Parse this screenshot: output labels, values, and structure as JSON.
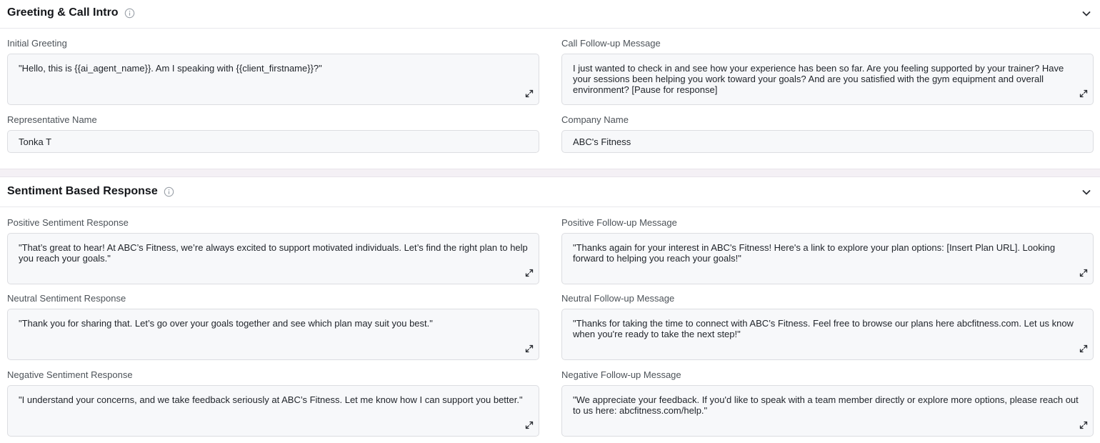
{
  "sections": {
    "greeting": {
      "title": "Greeting & Call Intro",
      "fields": {
        "initial_greeting": {
          "label": "Initial Greeting",
          "value": "\"Hello, this is {{ai_agent_name}}. Am I speaking with {{client_firstname}}?\""
        },
        "call_followup": {
          "label": "Call Follow-up Message",
          "value": "I just wanted to check in and see how your experience has been so far. Are you feeling supported by your trainer? Have your sessions been helping you work toward your goals? And are you satisfied with the gym equipment and overall environment? [Pause for response]"
        },
        "rep_name": {
          "label": "Representative Name",
          "value": "Tonka T"
        },
        "company_name": {
          "label": "Company Name",
          "value": "ABC's Fitness"
        }
      }
    },
    "sentiment": {
      "title": "Sentiment Based Response",
      "fields": {
        "positive_response": {
          "label": "Positive Sentiment Response",
          "value": "\"That’s great to hear! At ABC’s Fitness, we’re always excited to support motivated individuals. Let’s find the right plan to help you reach your goals.\""
        },
        "positive_followup": {
          "label": "Positive Follow-up Message",
          "value": "\"Thanks again for your interest in ABC's Fitness! Here's a link to explore your plan options: [Insert Plan URL]. Looking forward to helping you reach your goals!\""
        },
        "neutral_response": {
          "label": "Neutral Sentiment Response",
          "value": "\"Thank you for sharing that. Let’s go over your goals together and see which plan may suit you best.\""
        },
        "neutral_followup": {
          "label": "Neutral Follow-up Message",
          "value": "\"Thanks for taking the time to connect with ABC’s Fitness. Feel free to browse our plans here abcfitness.com. Let us know when you're ready to take the next step!\""
        },
        "negative_response": {
          "label": "Negative Sentiment Response",
          "value": "\"I understand your concerns, and we take feedback seriously at ABC’s Fitness. Let me know how I can support you better.\""
        },
        "negative_followup": {
          "label": "Negative Follow-up Message",
          "value": "\"We appreciate your feedback. If you'd like to speak with a team member directly or explore more options, please reach out to us here: abcfitness.com/help.\""
        }
      }
    }
  },
  "icons": {
    "info": "info-icon",
    "collapse": "chevron-down-icon",
    "expand": "expand-icon"
  }
}
